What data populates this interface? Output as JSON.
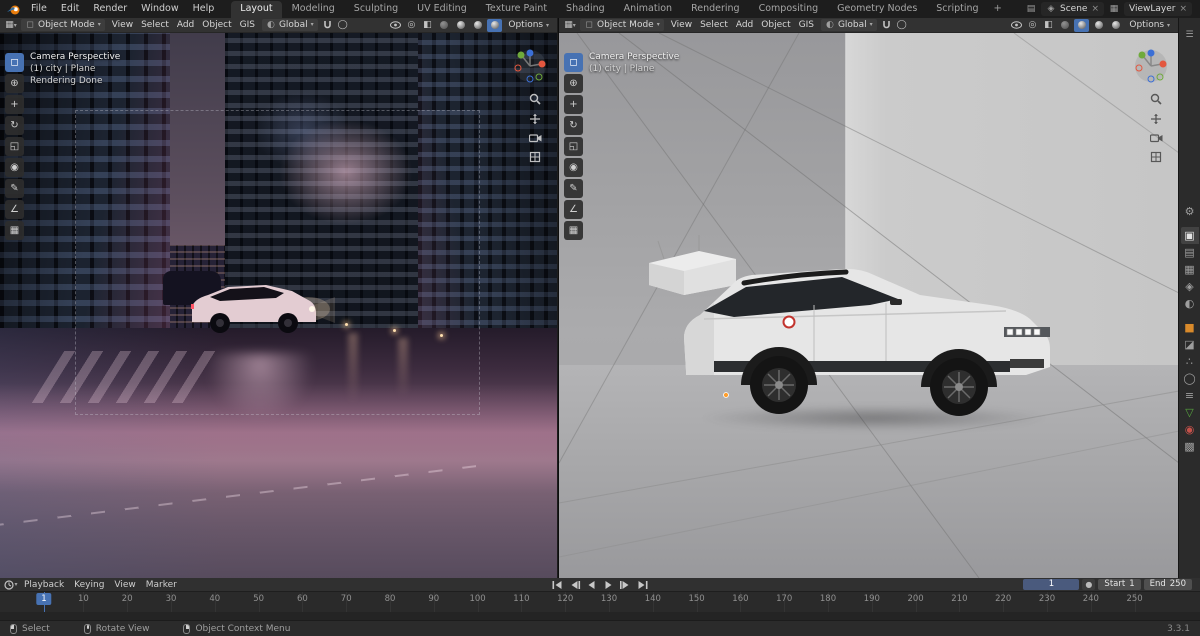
{
  "topbar": {
    "menus": [
      "File",
      "Edit",
      "Render",
      "Window",
      "Help"
    ],
    "tabs": [
      "Layout",
      "Modeling",
      "Sculpting",
      "UV Editing",
      "Texture Paint",
      "Shading",
      "Animation",
      "Rendering",
      "Compositing",
      "Geometry Nodes",
      "Scripting"
    ],
    "active_tab_index": 0,
    "new_tab_label": "+",
    "scene_label": "Scene",
    "viewlayer_label": "ViewLayer"
  },
  "viewport_left": {
    "mode_label": "Object Mode",
    "menus": [
      "View",
      "Select",
      "Add",
      "Object",
      "GIS"
    ],
    "orientation_label": "Global",
    "options_label": "Options",
    "overlay": {
      "line1": "Camera Perspective",
      "line2": "(1) city | Plane",
      "line3": "Rendering Done"
    }
  },
  "viewport_right": {
    "mode_label": "Object Mode",
    "menus": [
      "View",
      "Select",
      "Add",
      "Object",
      "GIS"
    ],
    "orientation_label": "Global",
    "options_label": "Options",
    "overlay": {
      "line1": "Camera Perspective",
      "line2": "(1) city | Plane"
    }
  },
  "timeline": {
    "menus": [
      "Playback",
      "Keying",
      "View",
      "Marker"
    ],
    "current_frame": "1",
    "start_label": "Start",
    "start_value": "1",
    "end_label": "End",
    "end_value": "250",
    "tick_start": 10,
    "tick_step": 10,
    "tick_end": 250
  },
  "statusbar": {
    "select_label": "Select",
    "rotate_label": "Rotate View",
    "context_label": "Object Context Menu",
    "version": "3.3.1"
  },
  "colors": {
    "accent": "#4772b3",
    "object_orange": "#e87d0d"
  }
}
